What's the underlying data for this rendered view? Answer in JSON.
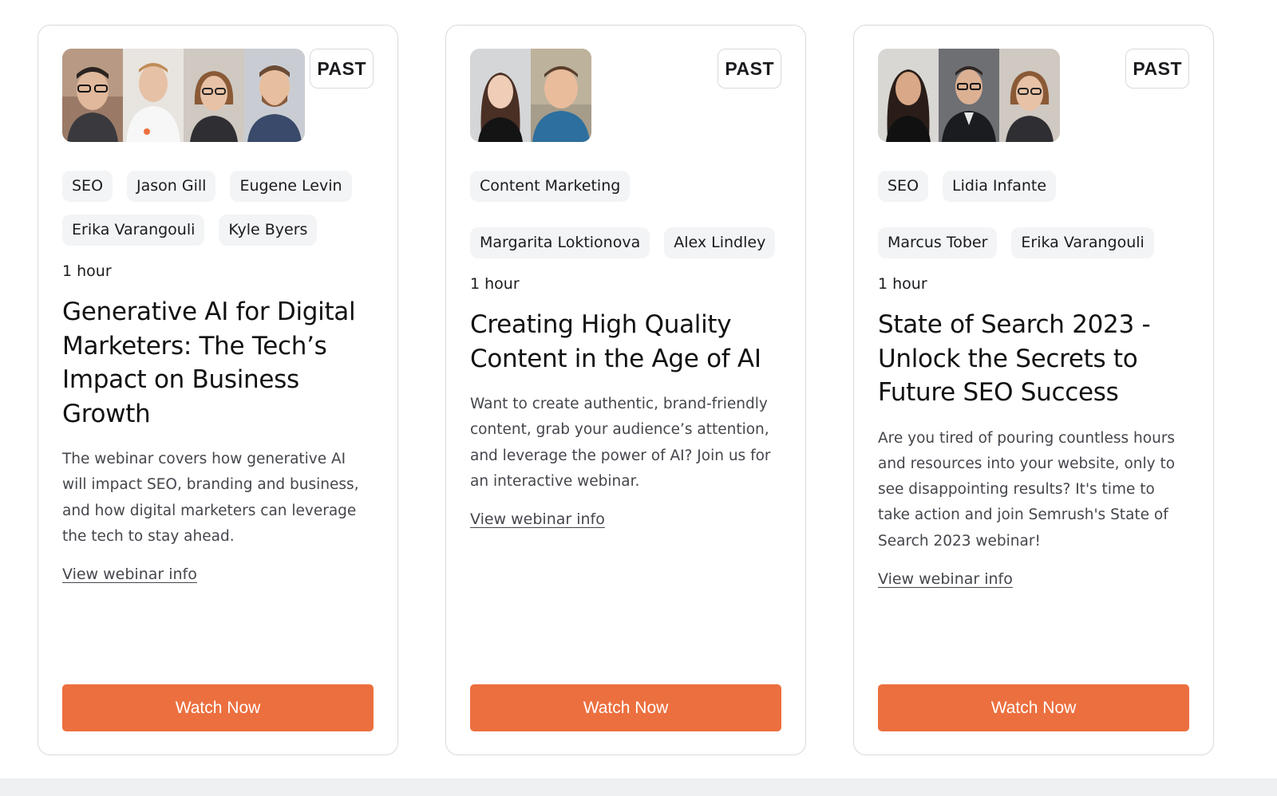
{
  "colors": {
    "accent": "#ec6f3f",
    "tag_bg": "#f3f4f6",
    "border": "#d8dadd"
  },
  "cards": [
    {
      "badge": "PAST",
      "tags": [
        "SEO",
        "Jason Gill",
        "Eugene Levin",
        "Erika Varangouli",
        "Kyle Byers"
      ],
      "duration": "1 hour",
      "title": "Generative AI for Digital Marketers: The Tech’s Impact on Business Growth",
      "description": "The webinar covers how generative AI will impact SEO, branding and business, and how digital marketers can leverage the tech to stay ahead.",
      "link": "View webinar info",
      "button": "Watch Now",
      "photos": [
        "jason-gill-photo",
        "eugene-levin-photo",
        "erika-varangouli-photo",
        "kyle-byers-photo"
      ]
    },
    {
      "badge": "PAST",
      "tags": [
        "Content Marketing",
        "Margarita Loktionova",
        "Alex Lindley"
      ],
      "duration": "1 hour",
      "title": "Creating High Quality Content in the Age of AI",
      "description": "Want to create authentic, brand-friendly content, grab your audience’s attention, and leverage the power of AI? Join us for an interactive webinar.",
      "link": "View webinar info",
      "button": "Watch Now",
      "photos": [
        "margarita-loktionova-photo",
        "alex-lindley-photo"
      ]
    },
    {
      "badge": "PAST",
      "tags": [
        "SEO",
        "Lidia Infante",
        "Marcus Tober",
        "Erika Varangouli"
      ],
      "duration": "1 hour",
      "title": "State of Search 2023 - Unlock the Secrets to Future SEO Success",
      "description": "Are you tired of pouring countless hours and resources into your website, only to see disappointing results? It's time to take action and join Semrush's State of Search 2023 webinar!",
      "link": "View webinar info",
      "button": "Watch Now",
      "photos": [
        "lidia-infante-photo",
        "marcus-tober-photo",
        "erika-varangouli-photo"
      ]
    }
  ]
}
